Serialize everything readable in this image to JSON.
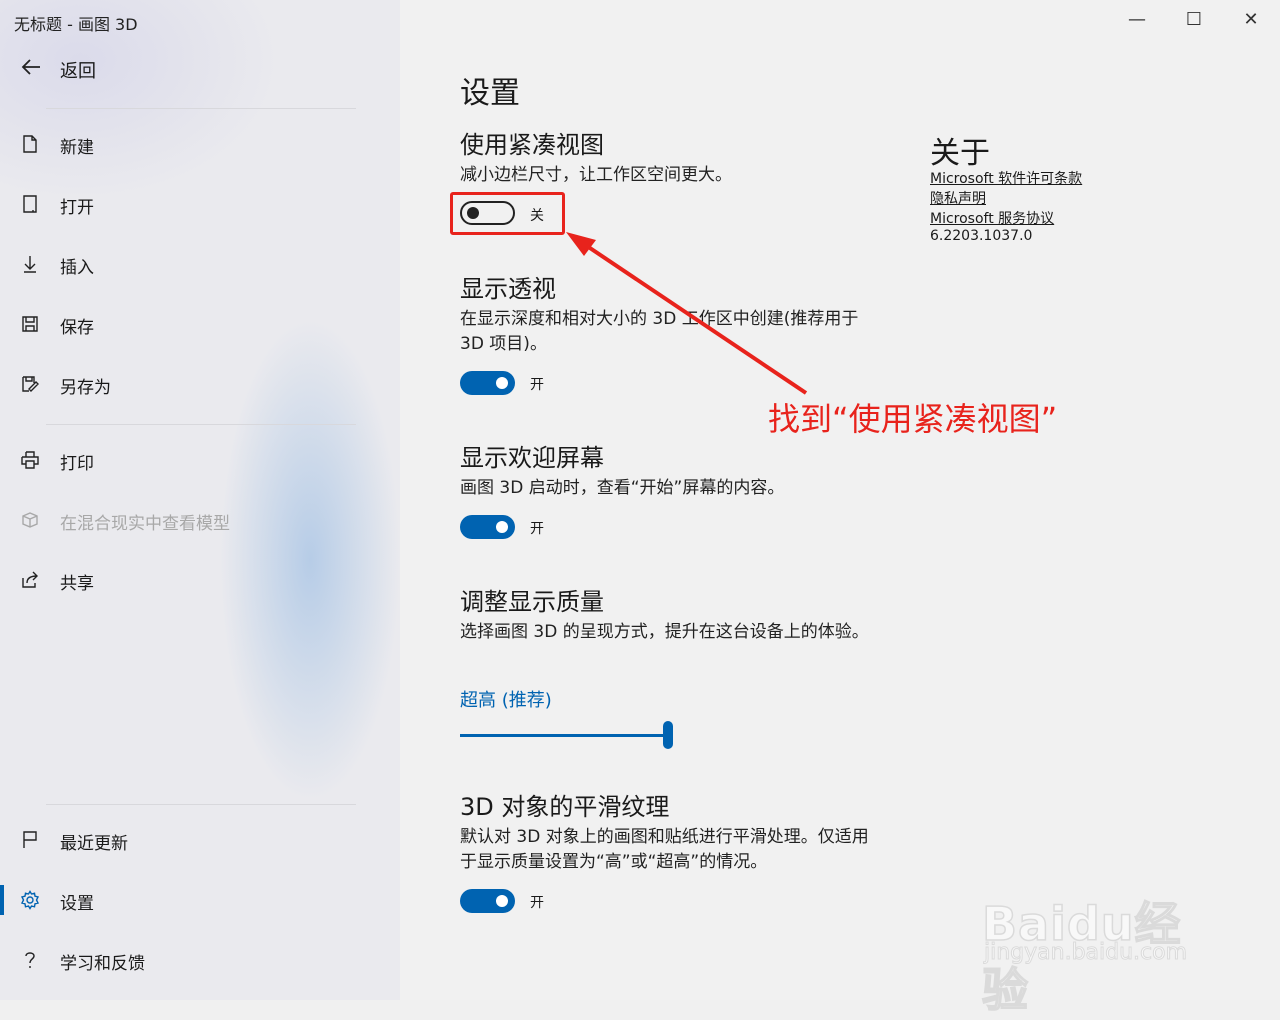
{
  "window": {
    "title": "无标题 - 画图 3D",
    "minimize": "—",
    "maximize": "☐",
    "close": "✕"
  },
  "sidebar": {
    "back_label": "返回",
    "items": [
      {
        "label": "新建",
        "icon": "new-file-icon"
      },
      {
        "label": "打开",
        "icon": "open-icon"
      },
      {
        "label": "插入",
        "icon": "insert-icon"
      },
      {
        "label": "保存",
        "icon": "save-icon"
      },
      {
        "label": "另存为",
        "icon": "save-as-icon"
      },
      {
        "label": "打印",
        "icon": "print-icon"
      },
      {
        "label": "在混合现实中查看模型",
        "icon": "mixed-reality-icon",
        "disabled": true
      },
      {
        "label": "共享",
        "icon": "share-icon"
      }
    ],
    "bottom_items": [
      {
        "label": "最近更新",
        "icon": "flag-icon"
      },
      {
        "label": "设置",
        "icon": "gear-icon",
        "active": true
      },
      {
        "label": "学习和反馈",
        "icon": "help-icon"
      }
    ],
    "accent_color": "#0063b1"
  },
  "settings": {
    "heading": "设置",
    "compact": {
      "title": "使用紧凑视图",
      "desc": "减小边栏尺寸，让工作区空间更大。",
      "state": "关",
      "on": false
    },
    "perspective": {
      "title": "显示透视",
      "desc": "在显示深度和相对大小的 3D 工作区中创建(推荐用于 3D 项目)。",
      "state": "开",
      "on": true
    },
    "welcome": {
      "title": "显示欢迎屏幕",
      "desc": "画图 3D 启动时，查看“开始”屏幕的内容。",
      "state": "开",
      "on": true
    },
    "quality": {
      "title": "调整显示质量",
      "desc": "选择画图 3D 的呈现方式，提升在这台设备上的体验。",
      "value": "超高 (推荐)",
      "slider_level": 1.0
    },
    "smooth": {
      "title": "3D 对象的平滑纹理",
      "desc": "默认对 3D 对象上的画图和贴纸进行平滑处理。仅适用于显示质量设置为“高”或“超高”的情况。",
      "state": "开",
      "on": true
    }
  },
  "about": {
    "title": "关于",
    "license": "Microsoft 软件许可条款",
    "privacy": "隐私声明",
    "services": "Microsoft 服务协议",
    "version": "6.2203.1037.0"
  },
  "annotation": {
    "text": "找到“使用紧凑视图”",
    "color": "#e8231c"
  },
  "watermark": {
    "main": "Baidu经验",
    "sub": "jingyan.baidu.com"
  }
}
